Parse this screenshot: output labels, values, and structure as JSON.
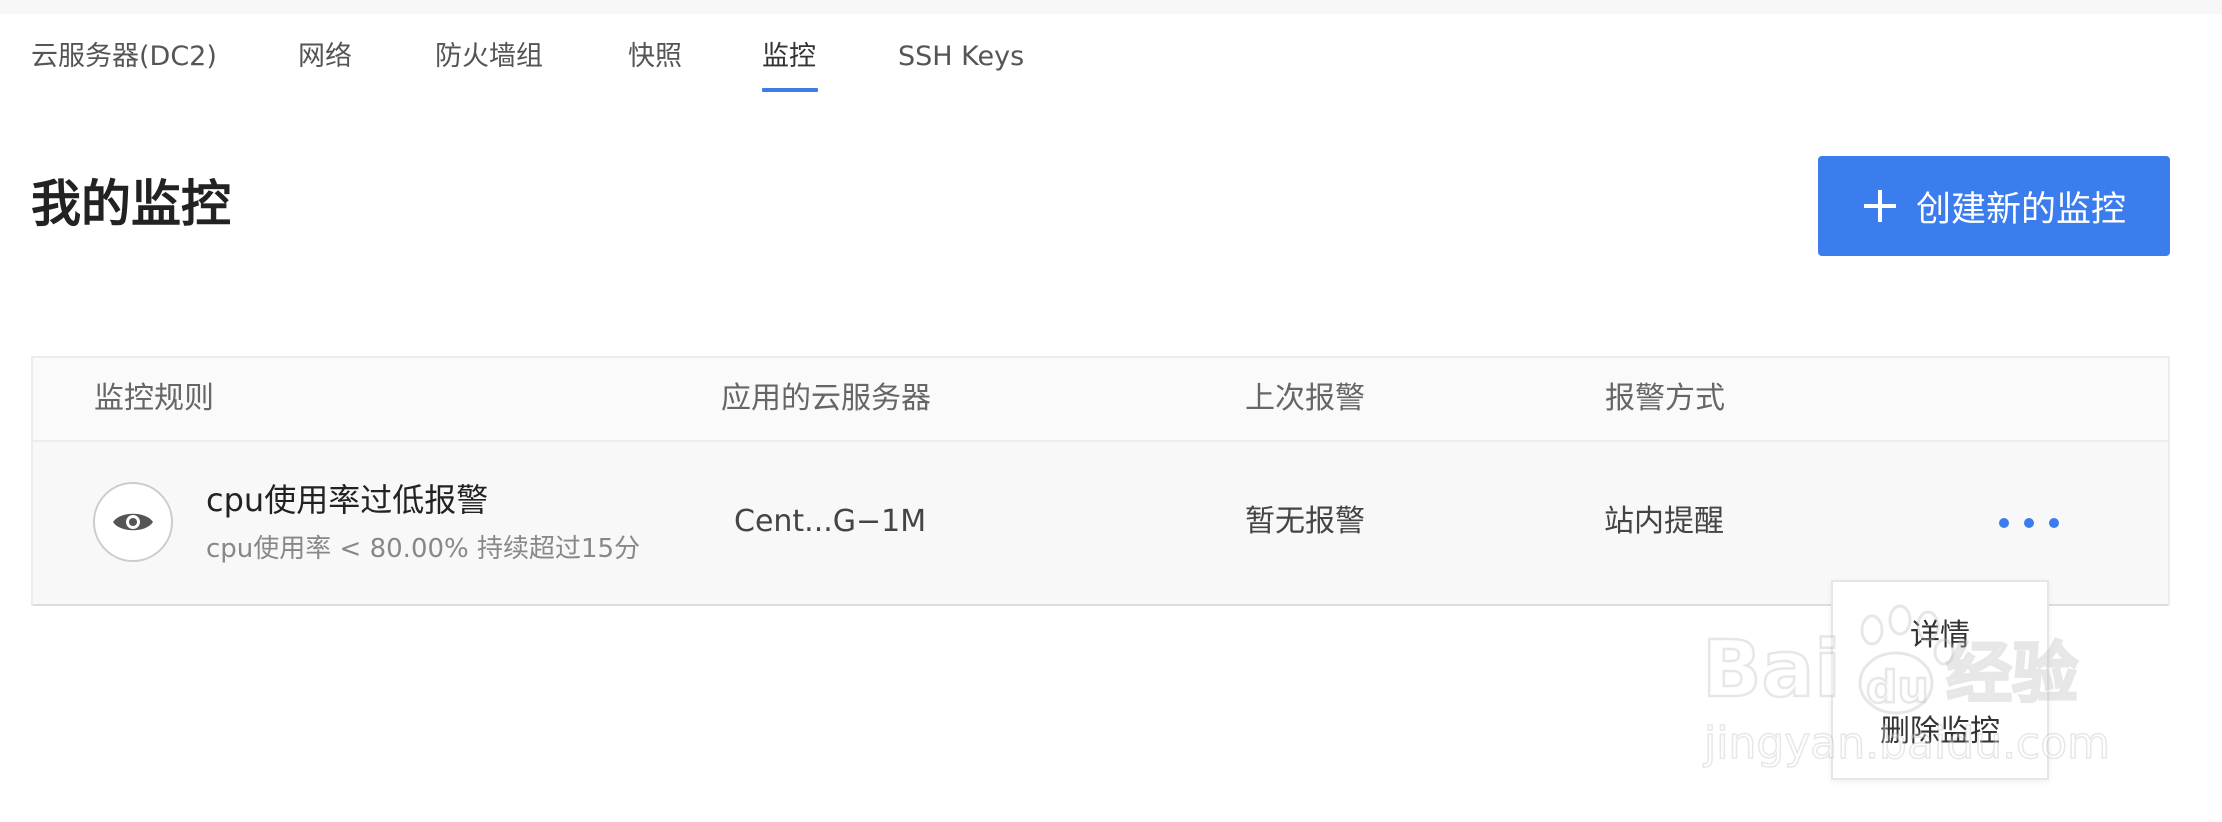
{
  "tabs": [
    {
      "label": "云服务器(DC2)"
    },
    {
      "label": "网络"
    },
    {
      "label": "防火墙组"
    },
    {
      "label": "快照"
    },
    {
      "label": "监控"
    },
    {
      "label": "SSH Keys"
    }
  ],
  "active_tab": "监控",
  "page": {
    "title": "我的监控",
    "create_button": "创建新的监控"
  },
  "table": {
    "columns": [
      "监控规则",
      "应用的云服务器",
      "上次报警",
      "报警方式"
    ],
    "rows": [
      {
        "rule_name": "cpu使用率过低报警",
        "rule_desc": "cpu使用率 < 80.00% 持续超过15分",
        "server": "Cent...G−1M",
        "last_alarm": "暂无报警",
        "alarm_method": "站内提醒"
      }
    ]
  },
  "menu": {
    "items": [
      "详情",
      "删除监控"
    ]
  },
  "watermark": {
    "brand_main": "Bai",
    "brand_paw_text": "du",
    "brand_suffix": "经验",
    "url": "jingyan.baidu.com"
  },
  "colors": {
    "accent": "#3b7ded",
    "text_primary": "#222222",
    "text_secondary": "#888888"
  },
  "icons": {
    "row_icon": "eye-icon",
    "create_icon": "plus-icon",
    "more_icon": "more-dots-icon"
  }
}
